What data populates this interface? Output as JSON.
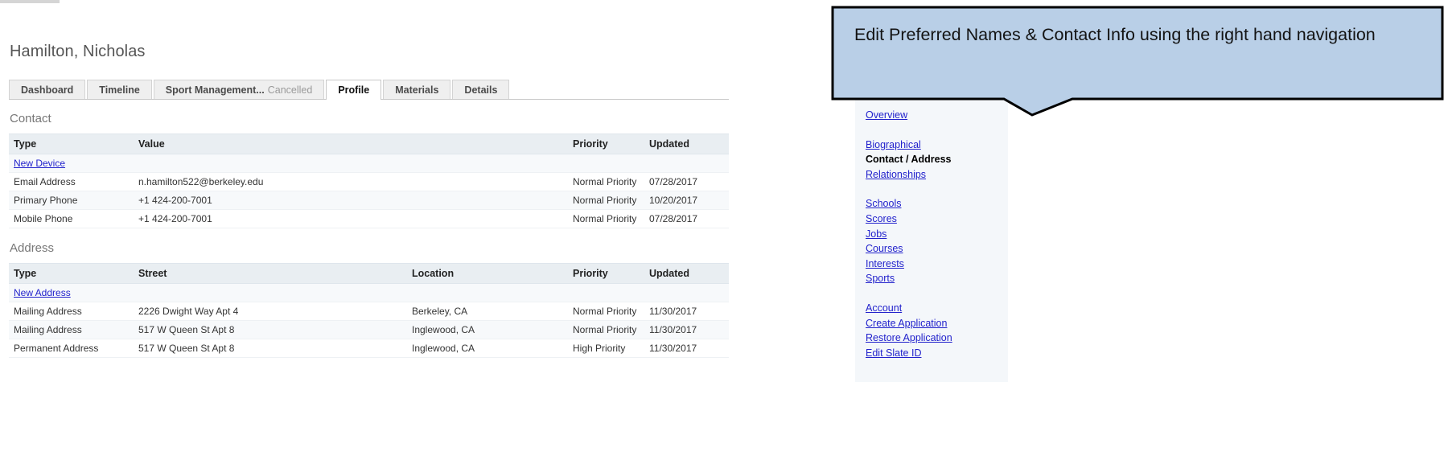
{
  "page_title": "Hamilton, Nicholas",
  "tabs": [
    {
      "label": "Dashboard",
      "suffix": "",
      "active": false
    },
    {
      "label": "Timeline",
      "suffix": "",
      "active": false
    },
    {
      "label": "Sport Management...",
      "suffix": "Cancelled",
      "active": false
    },
    {
      "label": "Profile",
      "suffix": "",
      "active": true
    },
    {
      "label": "Materials",
      "suffix": "",
      "active": false
    },
    {
      "label": "Details",
      "suffix": "",
      "active": false
    }
  ],
  "contact": {
    "heading": "Contact",
    "columns": [
      "Type",
      "Value",
      "Priority",
      "Updated"
    ],
    "new_link": "New Device",
    "rows": [
      {
        "type": "Email Address",
        "value": "n.hamilton522@berkeley.edu",
        "priority": "Normal Priority",
        "updated": "07/28/2017"
      },
      {
        "type": "Primary Phone",
        "value": "+1 424-200-7001",
        "priority": "Normal Priority",
        "updated": "10/20/2017"
      },
      {
        "type": "Mobile Phone",
        "value": "+1 424-200-7001",
        "priority": "Normal Priority",
        "updated": "07/28/2017"
      }
    ]
  },
  "address": {
    "heading": "Address",
    "columns": [
      "Type",
      "Street",
      "Location",
      "Priority",
      "Updated"
    ],
    "new_link": "New Address",
    "rows": [
      {
        "type": "Mailing Address",
        "street": "2226 Dwight Way Apt 4",
        "location": "Berkeley, CA",
        "priority": "Normal Priority",
        "updated": "11/30/2017"
      },
      {
        "type": "Mailing Address",
        "street": "517 W Queen St Apt 8",
        "location": "Inglewood, CA",
        "priority": "Normal Priority",
        "updated": "11/30/2017"
      },
      {
        "type": "Permanent Address",
        "street": "517 W Queen St Apt 8",
        "location": "Inglewood, CA",
        "priority": "High Priority",
        "updated": "11/30/2017"
      }
    ]
  },
  "sidenav": {
    "group1": [
      {
        "label": "Overview",
        "current": false
      }
    ],
    "group2": [
      {
        "label": "Biographical",
        "current": false
      },
      {
        "label": "Contact / Address",
        "current": true
      },
      {
        "label": "Relationships",
        "current": false
      }
    ],
    "group3": [
      {
        "label": "Schools",
        "current": false
      },
      {
        "label": "Scores",
        "current": false
      },
      {
        "label": "Jobs",
        "current": false
      },
      {
        "label": "Courses",
        "current": false
      },
      {
        "label": "Interests",
        "current": false
      },
      {
        "label": "Sports",
        "current": false
      }
    ],
    "group4": [
      {
        "label": "Account",
        "current": false
      },
      {
        "label": "Create Application",
        "current": false
      },
      {
        "label": "Restore Application",
        "current": false
      },
      {
        "label": "Edit Slate ID",
        "current": false
      }
    ]
  },
  "callout": {
    "text": "Edit Preferred Names & Contact Info using the right hand navigation",
    "fill": "#b9cfe7",
    "stroke": "#000000"
  }
}
